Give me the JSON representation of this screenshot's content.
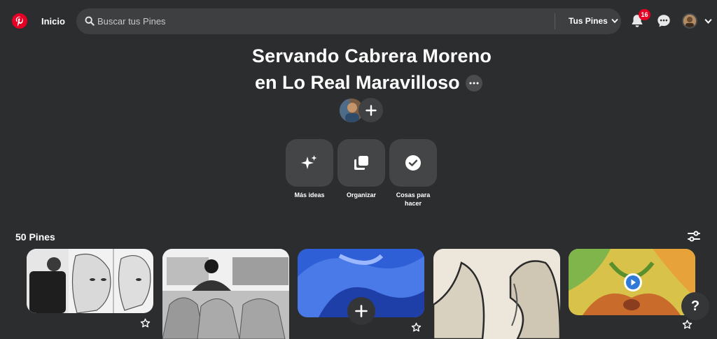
{
  "header": {
    "home_label": "Inicio",
    "search_placeholder": "Buscar tus Pines",
    "scope_label": "Tus Pines",
    "notifications_count": "16"
  },
  "board": {
    "title_line1": "Servando Cabrera Moreno",
    "title_line2": "en Lo Real Maravilloso"
  },
  "actions": [
    {
      "label": "Más ideas",
      "icon": "sparkle-icon"
    },
    {
      "label": "Organizar",
      "icon": "organize-icon"
    },
    {
      "label": "Cosas para hacer",
      "icon": "checkmark-icon"
    }
  ],
  "pins": {
    "count_label": "50 Pines"
  },
  "help_label": "?",
  "colors": {
    "background": "#2b2d2f",
    "brand_red": "#e60023",
    "surface": "#434547"
  }
}
